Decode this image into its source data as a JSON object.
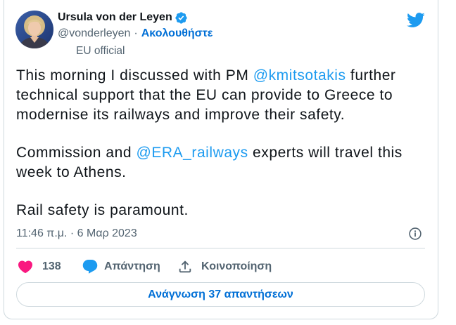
{
  "author": {
    "name": "Ursula von der Leyen",
    "handle": "@vonderleyen",
    "separator": "·",
    "follow_label": "Ακολουθήστε",
    "affiliation": "EU official",
    "verified": true
  },
  "tweet": {
    "paragraphs": [
      [
        [
          "This morning I discussed with PM ",
          "@kmitsotakis",
          " further"
        ],
        [
          "technical support that the EU can provide to Greece to"
        ],
        [
          "modernise its railways and improve their safety."
        ]
      ],
      [
        [
          "Commission and ",
          "@ERA_railways",
          " experts will travel this"
        ],
        [
          "week to Athens."
        ]
      ],
      [
        [
          "Rail safety is paramount."
        ]
      ]
    ],
    "timestamp": "11:46 π.μ. · 6 Μαρ 2023"
  },
  "actions": {
    "like_count": "138",
    "reply_label": "Απάντηση",
    "share_label": "Κοινοποίηση"
  },
  "read_replies_label": "Ανάγνωση 37 απαντήσεων",
  "icons": {
    "verified": "verified-badge-icon",
    "logo": "twitter-bird-icon",
    "info": "info-icon",
    "like": "heart-icon",
    "reply": "comment-icon",
    "share": "share-icon"
  },
  "colors": {
    "text": "#0f1419",
    "secondary": "#536471",
    "accent": "#1d9bf0",
    "link": "#006fd6",
    "like": "#f91880",
    "border": "#cfd9de"
  }
}
